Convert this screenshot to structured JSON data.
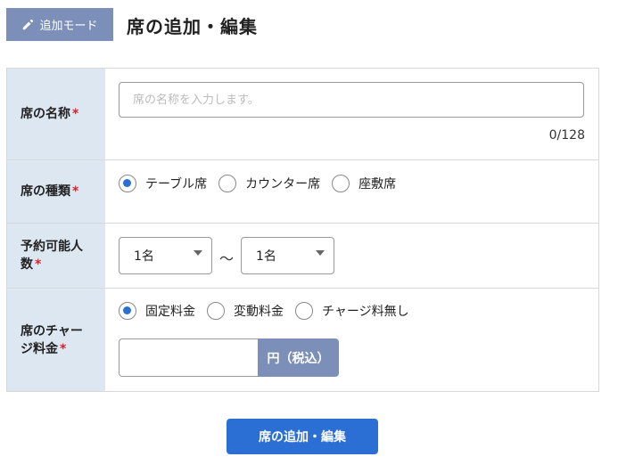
{
  "header": {
    "mode_label": "追加モード",
    "title": "席の追加・編集"
  },
  "form": {
    "required_mark": "*",
    "seat_name": {
      "label": "席の名称",
      "placeholder": "席の名称を入力します。",
      "value": "",
      "counter": "0/128"
    },
    "seat_type": {
      "label": "席の種類",
      "options": [
        "テーブル席",
        "カウンター席",
        "座敷席"
      ],
      "selected": "テーブル席"
    },
    "capacity": {
      "label_line1": "予約可能人",
      "label_line2": "数",
      "min_value": "1名",
      "separator": "〜",
      "max_value": "1名"
    },
    "charge": {
      "label_line1": "席のチャー",
      "label_line2": "ジ料金",
      "options": [
        "固定料金",
        "変動料金",
        "チャージ料無し"
      ],
      "selected": "固定料金",
      "amount_value": "",
      "unit": "円（税込）"
    }
  },
  "submit_label": "席の追加・編集",
  "colors": {
    "accent_blue": "#2c6fd4",
    "muted_blue": "#7b8fb8",
    "label_bg": "#dde7f1",
    "required_red": "#d0262d"
  }
}
